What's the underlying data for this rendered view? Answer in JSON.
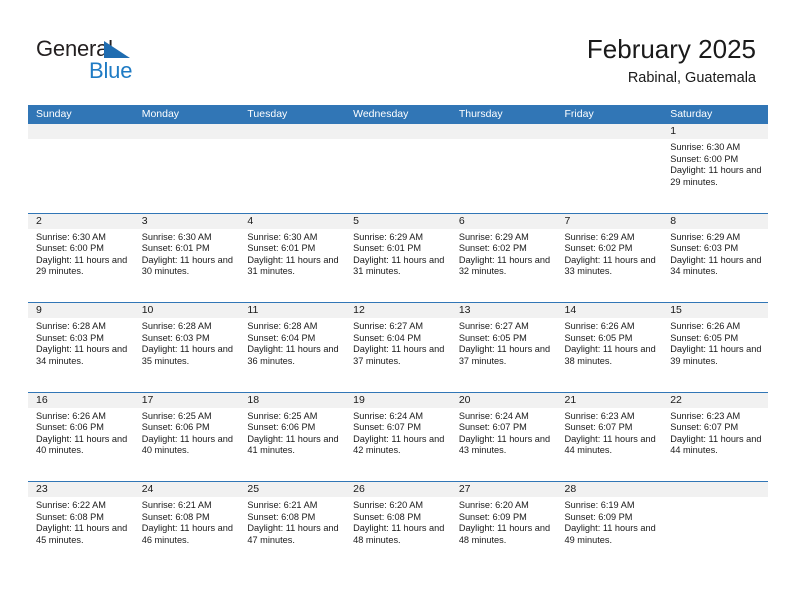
{
  "brand": {
    "name_part1": "General",
    "name_part2": "Blue",
    "triangle_color": "#1f6cb0",
    "blue_color": "#1f7bc4"
  },
  "header": {
    "month_title": "February 2025",
    "location": "Rabinal, Guatemala"
  },
  "theme": {
    "header_blue": "#3176b6",
    "day_band_gray": "#f1f1f1",
    "text_color": "#1a1a1a"
  },
  "weekdays": [
    "Sunday",
    "Monday",
    "Tuesday",
    "Wednesday",
    "Thursday",
    "Friday",
    "Saturday"
  ],
  "weeks": [
    [
      {
        "day": "",
        "sunrise": "",
        "sunset": "",
        "daylight": "",
        "empty": true
      },
      {
        "day": "",
        "sunrise": "",
        "sunset": "",
        "daylight": "",
        "empty": true
      },
      {
        "day": "",
        "sunrise": "",
        "sunset": "",
        "daylight": "",
        "empty": true
      },
      {
        "day": "",
        "sunrise": "",
        "sunset": "",
        "daylight": "",
        "empty": true
      },
      {
        "day": "",
        "sunrise": "",
        "sunset": "",
        "daylight": "",
        "empty": true
      },
      {
        "day": "",
        "sunrise": "",
        "sunset": "",
        "daylight": "",
        "empty": true
      },
      {
        "day": "1",
        "sunrise": "Sunrise: 6:30 AM",
        "sunset": "Sunset: 6:00 PM",
        "daylight": "Daylight: 11 hours and 29 minutes.",
        "empty": false
      }
    ],
    [
      {
        "day": "2",
        "sunrise": "Sunrise: 6:30 AM",
        "sunset": "Sunset: 6:00 PM",
        "daylight": "Daylight: 11 hours and 29 minutes.",
        "empty": false
      },
      {
        "day": "3",
        "sunrise": "Sunrise: 6:30 AM",
        "sunset": "Sunset: 6:01 PM",
        "daylight": "Daylight: 11 hours and 30 minutes.",
        "empty": false
      },
      {
        "day": "4",
        "sunrise": "Sunrise: 6:30 AM",
        "sunset": "Sunset: 6:01 PM",
        "daylight": "Daylight: 11 hours and 31 minutes.",
        "empty": false
      },
      {
        "day": "5",
        "sunrise": "Sunrise: 6:29 AM",
        "sunset": "Sunset: 6:01 PM",
        "daylight": "Daylight: 11 hours and 31 minutes.",
        "empty": false
      },
      {
        "day": "6",
        "sunrise": "Sunrise: 6:29 AM",
        "sunset": "Sunset: 6:02 PM",
        "daylight": "Daylight: 11 hours and 32 minutes.",
        "empty": false
      },
      {
        "day": "7",
        "sunrise": "Sunrise: 6:29 AM",
        "sunset": "Sunset: 6:02 PM",
        "daylight": "Daylight: 11 hours and 33 minutes.",
        "empty": false
      },
      {
        "day": "8",
        "sunrise": "Sunrise: 6:29 AM",
        "sunset": "Sunset: 6:03 PM",
        "daylight": "Daylight: 11 hours and 34 minutes.",
        "empty": false
      }
    ],
    [
      {
        "day": "9",
        "sunrise": "Sunrise: 6:28 AM",
        "sunset": "Sunset: 6:03 PM",
        "daylight": "Daylight: 11 hours and 34 minutes.",
        "empty": false
      },
      {
        "day": "10",
        "sunrise": "Sunrise: 6:28 AM",
        "sunset": "Sunset: 6:03 PM",
        "daylight": "Daylight: 11 hours and 35 minutes.",
        "empty": false
      },
      {
        "day": "11",
        "sunrise": "Sunrise: 6:28 AM",
        "sunset": "Sunset: 6:04 PM",
        "daylight": "Daylight: 11 hours and 36 minutes.",
        "empty": false
      },
      {
        "day": "12",
        "sunrise": "Sunrise: 6:27 AM",
        "sunset": "Sunset: 6:04 PM",
        "daylight": "Daylight: 11 hours and 37 minutes.",
        "empty": false
      },
      {
        "day": "13",
        "sunrise": "Sunrise: 6:27 AM",
        "sunset": "Sunset: 6:05 PM",
        "daylight": "Daylight: 11 hours and 37 minutes.",
        "empty": false
      },
      {
        "day": "14",
        "sunrise": "Sunrise: 6:26 AM",
        "sunset": "Sunset: 6:05 PM",
        "daylight": "Daylight: 11 hours and 38 minutes.",
        "empty": false
      },
      {
        "day": "15",
        "sunrise": "Sunrise: 6:26 AM",
        "sunset": "Sunset: 6:05 PM",
        "daylight": "Daylight: 11 hours and 39 minutes.",
        "empty": false
      }
    ],
    [
      {
        "day": "16",
        "sunrise": "Sunrise: 6:26 AM",
        "sunset": "Sunset: 6:06 PM",
        "daylight": "Daylight: 11 hours and 40 minutes.",
        "empty": false
      },
      {
        "day": "17",
        "sunrise": "Sunrise: 6:25 AM",
        "sunset": "Sunset: 6:06 PM",
        "daylight": "Daylight: 11 hours and 40 minutes.",
        "empty": false
      },
      {
        "day": "18",
        "sunrise": "Sunrise: 6:25 AM",
        "sunset": "Sunset: 6:06 PM",
        "daylight": "Daylight: 11 hours and 41 minutes.",
        "empty": false
      },
      {
        "day": "19",
        "sunrise": "Sunrise: 6:24 AM",
        "sunset": "Sunset: 6:07 PM",
        "daylight": "Daylight: 11 hours and 42 minutes.",
        "empty": false
      },
      {
        "day": "20",
        "sunrise": "Sunrise: 6:24 AM",
        "sunset": "Sunset: 6:07 PM",
        "daylight": "Daylight: 11 hours and 43 minutes.",
        "empty": false
      },
      {
        "day": "21",
        "sunrise": "Sunrise: 6:23 AM",
        "sunset": "Sunset: 6:07 PM",
        "daylight": "Daylight: 11 hours and 44 minutes.",
        "empty": false
      },
      {
        "day": "22",
        "sunrise": "Sunrise: 6:23 AM",
        "sunset": "Sunset: 6:07 PM",
        "daylight": "Daylight: 11 hours and 44 minutes.",
        "empty": false
      }
    ],
    [
      {
        "day": "23",
        "sunrise": "Sunrise: 6:22 AM",
        "sunset": "Sunset: 6:08 PM",
        "daylight": "Daylight: 11 hours and 45 minutes.",
        "empty": false
      },
      {
        "day": "24",
        "sunrise": "Sunrise: 6:21 AM",
        "sunset": "Sunset: 6:08 PM",
        "daylight": "Daylight: 11 hours and 46 minutes.",
        "empty": false
      },
      {
        "day": "25",
        "sunrise": "Sunrise: 6:21 AM",
        "sunset": "Sunset: 6:08 PM",
        "daylight": "Daylight: 11 hours and 47 minutes.",
        "empty": false
      },
      {
        "day": "26",
        "sunrise": "Sunrise: 6:20 AM",
        "sunset": "Sunset: 6:08 PM",
        "daylight": "Daylight: 11 hours and 48 minutes.",
        "empty": false
      },
      {
        "day": "27",
        "sunrise": "Sunrise: 6:20 AM",
        "sunset": "Sunset: 6:09 PM",
        "daylight": "Daylight: 11 hours and 48 minutes.",
        "empty": false
      },
      {
        "day": "28",
        "sunrise": "Sunrise: 6:19 AM",
        "sunset": "Sunset: 6:09 PM",
        "daylight": "Daylight: 11 hours and 49 minutes.",
        "empty": false
      },
      {
        "day": "",
        "sunrise": "",
        "sunset": "",
        "daylight": "",
        "empty": true
      }
    ]
  ]
}
